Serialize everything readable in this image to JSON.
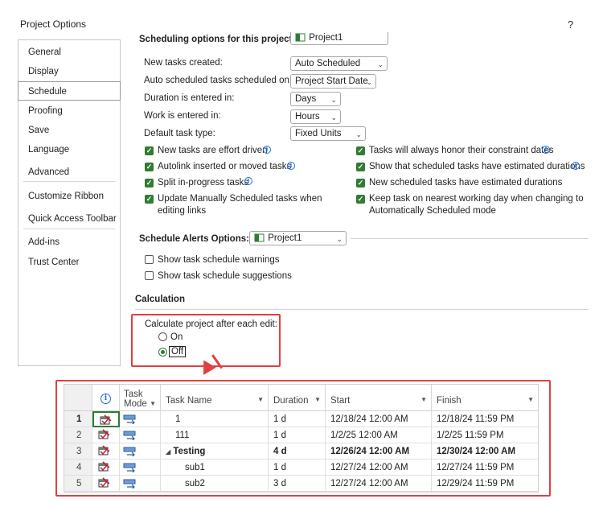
{
  "dialog": {
    "title": "Project Options",
    "help": "?"
  },
  "nav": {
    "items": [
      "General",
      "Display",
      "Schedule",
      "Proofing",
      "Save",
      "Language",
      "Advanced",
      "Customize Ribbon",
      "Quick Access Toolbar",
      "Add-ins",
      "Trust Center"
    ],
    "selected": "Schedule"
  },
  "schedule": {
    "header_partial": "Scheduling options for this project:",
    "header_project": "Project1",
    "rows": [
      {
        "label": "New tasks created:",
        "value": "Auto Scheduled"
      },
      {
        "label": "Auto scheduled tasks scheduled on:",
        "value": "Project Start Date"
      },
      {
        "label": "Duration is entered in:",
        "value": "Days"
      },
      {
        "label": "Work is entered in:",
        "value": "Hours"
      },
      {
        "label": "Default task type:",
        "value": "Fixed Units"
      }
    ],
    "checks_left": [
      "New tasks are effort driven",
      "Autolink inserted or moved tasks",
      "Split in-progress tasks",
      "Update Manually Scheduled tasks when",
      "editing links"
    ],
    "checks_right": [
      "Tasks will always honor their constraint dates",
      "Show that scheduled tasks have estimated durations",
      "New scheduled tasks have estimated durations",
      "Keep task on nearest working day when changing to",
      "Automatically Scheduled mode"
    ]
  },
  "alerts": {
    "title": "Schedule Alerts Options:",
    "project": "Project1",
    "options": [
      "Show task schedule warnings",
      "Show task schedule suggestions"
    ]
  },
  "calculation": {
    "title": "Calculation",
    "prompt": "Calculate project after each edit:",
    "on_label": "On",
    "off_label": "Off",
    "selected": "Off"
  },
  "grid": {
    "headers": {
      "info": "i",
      "mode_line1": "Task",
      "mode_line2": "Mode",
      "name": "Task Name",
      "duration": "Duration",
      "start": "Start",
      "finish": "Finish"
    },
    "rows": [
      {
        "num": "1",
        "name": "1",
        "duration": "1 d",
        "start": "12/18/24 12:00 AM",
        "finish": "12/18/24 11:59 PM",
        "bold": false,
        "indent": 0
      },
      {
        "num": "2",
        "name": "111",
        "duration": "1 d",
        "start": "1/2/25 12:00 AM",
        "finish": "1/2/25 11:59 PM",
        "bold": false,
        "indent": 0
      },
      {
        "num": "3",
        "name": "Testing",
        "duration": "4 d",
        "start": "12/26/24 12:00 AM",
        "finish": "12/30/24 12:00 AM",
        "bold": true,
        "indent": 0
      },
      {
        "num": "4",
        "name": "sub1",
        "duration": "1 d",
        "start": "12/27/24 12:00 AM",
        "finish": "12/27/24 11:59 PM",
        "bold": false,
        "indent": 1
      },
      {
        "num": "5",
        "name": "sub2",
        "duration": "3 d",
        "start": "12/27/24 12:00 AM",
        "finish": "12/29/24 11:59 PM",
        "bold": false,
        "indent": 1
      }
    ],
    "collapse_glyph": "◢"
  },
  "colors": {
    "accent_green": "#2e7d32",
    "highlight_red": "#e04040",
    "info_blue": "#1e6fd9"
  }
}
